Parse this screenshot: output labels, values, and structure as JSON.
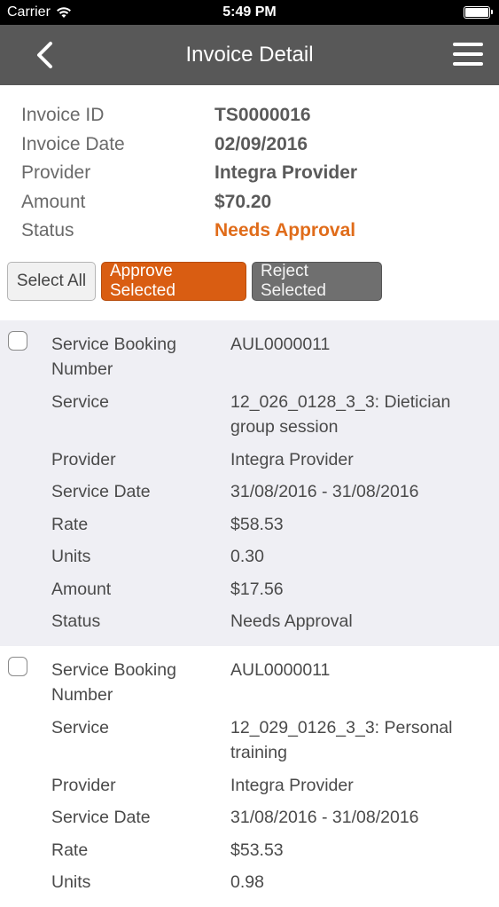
{
  "status_bar": {
    "carrier": "Carrier",
    "time": "5:49 PM"
  },
  "navbar": {
    "title": "Invoice Detail",
    "back_icon": "chevron-left-icon",
    "menu_icon": "hamburger-menu-icon"
  },
  "invoice": {
    "rows": [
      {
        "label": "Invoice ID",
        "value": "TS0000016"
      },
      {
        "label": "Invoice Date",
        "value": "02/09/2016"
      },
      {
        "label": "Provider",
        "value": "Integra Provider"
      },
      {
        "label": "Amount",
        "value": "$70.20"
      },
      {
        "label": "Status",
        "value": "Needs Approval"
      }
    ]
  },
  "actions": {
    "select_all": "Select All",
    "approve": "Approve Selected",
    "reject": "Reject Selected"
  },
  "colors": {
    "accent": "#d95d12",
    "status": "#e06c1a",
    "nav": "#585858"
  },
  "items": [
    {
      "checked": false,
      "rows": [
        {
          "label": "Service Booking Number",
          "value": "AUL0000011"
        },
        {
          "label": "Service",
          "value": "12_026_0128_3_3: Dietician group session"
        },
        {
          "label": "Provider",
          "value": "Integra Provider"
        },
        {
          "label": "Service Date",
          "value": "31/08/2016 - 31/08/2016"
        },
        {
          "label": "Rate",
          "value": "$58.53"
        },
        {
          "label": "Units",
          "value": "0.30"
        },
        {
          "label": "Amount",
          "value": "$17.56"
        },
        {
          "label": "Status",
          "value": "Needs Approval"
        }
      ]
    },
    {
      "checked": false,
      "rows": [
        {
          "label": "Service Booking Number",
          "value": "AUL0000011"
        },
        {
          "label": "Service",
          "value": "12_029_0126_3_3: Personal training"
        },
        {
          "label": "Provider",
          "value": "Integra Provider"
        },
        {
          "label": "Service Date",
          "value": "31/08/2016 - 31/08/2016"
        },
        {
          "label": "Rate",
          "value": "$53.53"
        },
        {
          "label": "Units",
          "value": "0.98"
        }
      ]
    }
  ]
}
